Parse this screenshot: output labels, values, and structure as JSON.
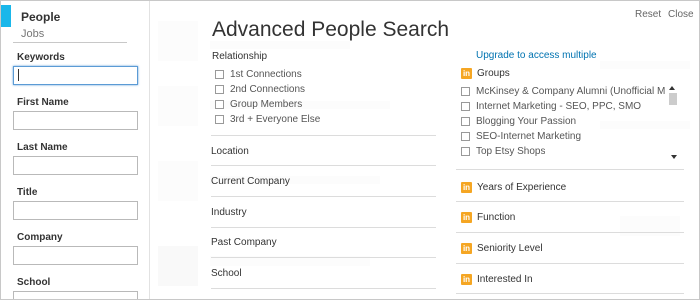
{
  "sidebar": {
    "nav": {
      "people": "People",
      "jobs": "Jobs"
    },
    "fields": {
      "keywords": "Keywords",
      "first_name": "First Name",
      "last_name": "Last Name",
      "title": "Title",
      "company": "Company",
      "school": "School"
    }
  },
  "header": {
    "title": "Advanced People Search",
    "reset": "Reset",
    "close": "Close"
  },
  "relationship": {
    "label": "Relationship",
    "options": [
      "1st Connections",
      "2nd Connections",
      "Group Members",
      "3rd + Everyone Else"
    ]
  },
  "filters": [
    "Location",
    "Current Company",
    "Industry",
    "Past Company",
    "School"
  ],
  "right": {
    "upgrade": "Upgrade to access multiple",
    "groups_label": "Groups",
    "groups": [
      "McKinsey & Company Alumni (Unofficial M...",
      "Internet Marketing - SEO, PPC, SMO",
      "Blogging Your Passion",
      "SEO-Internet Marketing",
      "Top Etsy Shops"
    ],
    "premium_filters": [
      "Years of Experience",
      "Function",
      "Seniority Level",
      "Interested In"
    ],
    "badge": "in"
  },
  "colors": {
    "accent": "#1ab7ea",
    "link": "#0073b1",
    "premium_badge": "#f5a623"
  }
}
